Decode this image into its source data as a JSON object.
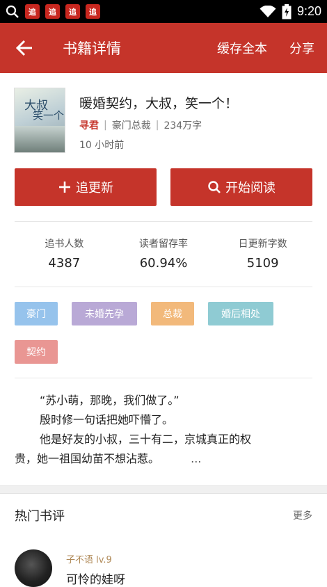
{
  "status_bar": {
    "app_badges": [
      "追",
      "追",
      "追",
      "追"
    ],
    "time": "9:20"
  },
  "app_bar": {
    "title": "书籍详情",
    "cache_all": "缓存全本",
    "share": "分享"
  },
  "book": {
    "title": "暖婚契约，大叔，笑一个！",
    "author": "寻君",
    "category": "豪门总裁",
    "word_count": "234万字",
    "updated": "10 小时前",
    "cover_text": [
      "大叔",
      "笑一个"
    ]
  },
  "buttons": {
    "follow": "追更新",
    "read": "开始阅读"
  },
  "stats": [
    {
      "label": "追书人数",
      "value": "4387"
    },
    {
      "label": "读者留存率",
      "value": "60.94%"
    },
    {
      "label": "日更新字数",
      "value": "5109"
    }
  ],
  "tags": [
    {
      "label": "豪门",
      "color": "#96c3ec"
    },
    {
      "label": "未婚先孕",
      "color": "#b9a9d6"
    },
    {
      "label": "总裁",
      "color": "#f2b97b"
    },
    {
      "label": "婚后相处",
      "color": "#8fcbd3"
    },
    {
      "label": "契约",
      "color": "#e99693"
    }
  ],
  "description": {
    "line1": "“苏小萌，那晚，我们做了。”",
    "line2": "殷时修一句话把她吓懵了。",
    "line3": "他是好友的小叔，三十有二，京城真正的权",
    "line4": "贵，她一祖国幼苗不想沾惹。",
    "ellipsis": "..."
  },
  "reviews": {
    "title": "热门书评",
    "more": "更多",
    "items": [
      {
        "user": "子不语 lv.9",
        "text": "可怜的娃呀"
      }
    ]
  }
}
